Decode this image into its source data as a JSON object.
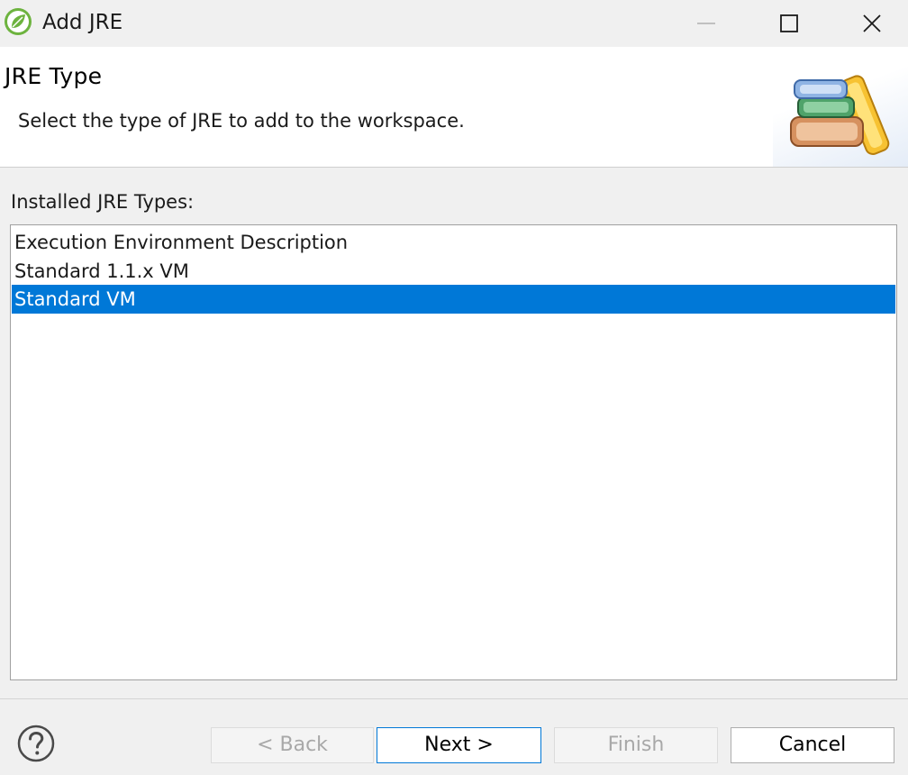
{
  "window": {
    "title": "Add JRE",
    "icon": "spring-leaf-icon",
    "controls": [
      "minimize-icon",
      "maximize-icon",
      "close-icon"
    ]
  },
  "banner": {
    "title": "JRE Type",
    "description": "Select the type of JRE to add to the workspace.",
    "image": "books-icon"
  },
  "content": {
    "list_caption": "Installed JRE Types:",
    "items": [
      {
        "label": "Execution Environment Description",
        "selected": false
      },
      {
        "label": "Standard 1.1.x VM",
        "selected": false
      },
      {
        "label": "Standard VM",
        "selected": true
      }
    ]
  },
  "footer": {
    "help_icon": "help-icon",
    "back_label": "< Back",
    "next_label": "Next >",
    "finish_label": "Finish",
    "cancel_label": "Cancel"
  },
  "colors": {
    "selection": "#0078d7",
    "default_button_border": "#0078d7",
    "disabled_text": "#a8a8a8"
  }
}
